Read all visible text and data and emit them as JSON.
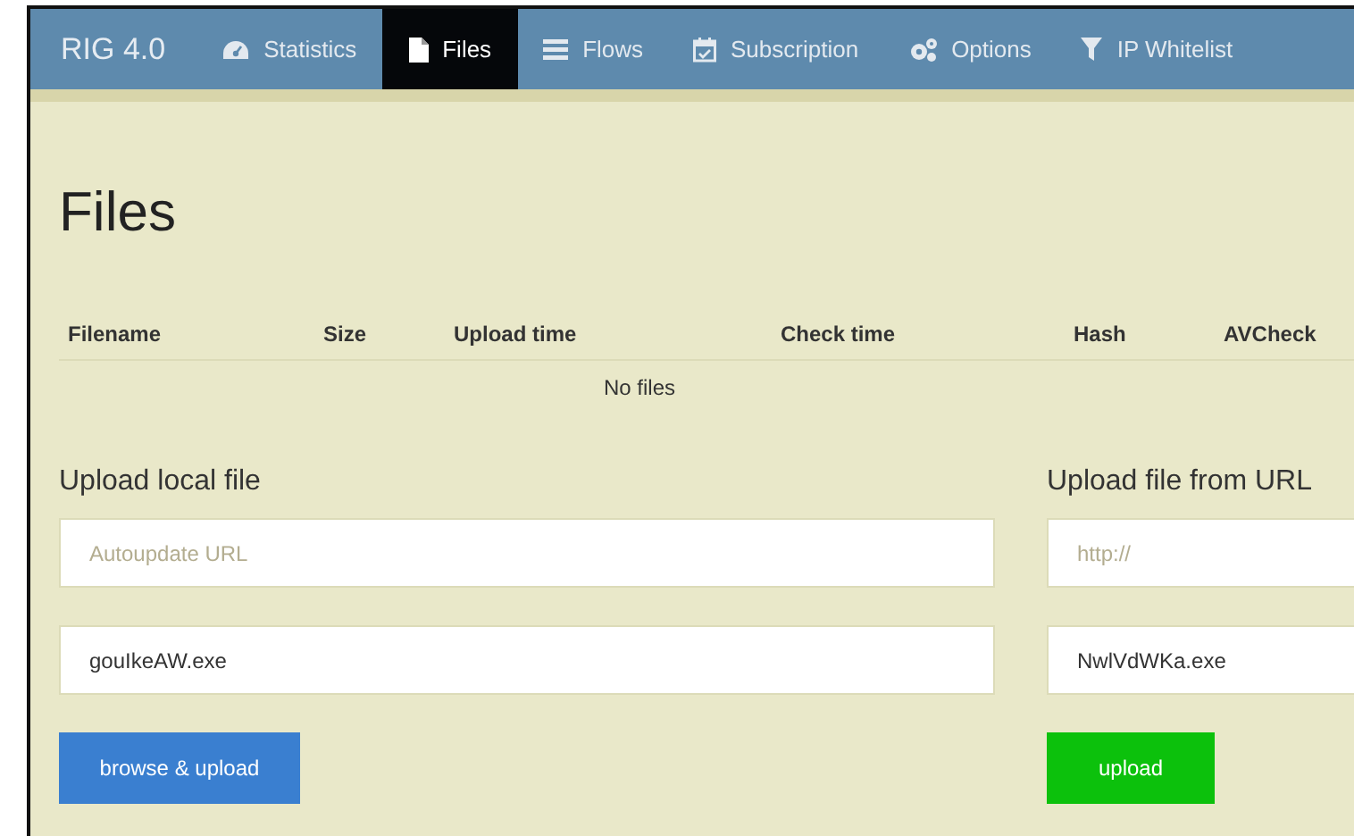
{
  "nav": {
    "brand": "RIG 4.0",
    "tabs": [
      {
        "label": "Statistics",
        "selected": false
      },
      {
        "label": "Files",
        "selected": true
      },
      {
        "label": "Flows",
        "selected": false
      },
      {
        "label": "Subscription",
        "selected": false
      },
      {
        "label": "Options",
        "selected": false
      },
      {
        "label": "IP Whitelist",
        "selected": false
      }
    ]
  },
  "heading": "Files",
  "table": {
    "columns": [
      "Filename",
      "Size",
      "Upload time",
      "Check time",
      "Hash",
      "AVCheck"
    ],
    "empty_text": "No files"
  },
  "local_upload": {
    "title": "Upload local file",
    "url_field": {
      "placeholder": "Autoupdate URL"
    },
    "name_field": {
      "value": "gouIkeAW.exe"
    },
    "button": "browse & upload"
  },
  "url_upload": {
    "title": "Upload file from URL",
    "url_field": {
      "placeholder": "http://"
    },
    "name_field": {
      "value": "NwlVdWKa.exe"
    },
    "button": "upload"
  }
}
